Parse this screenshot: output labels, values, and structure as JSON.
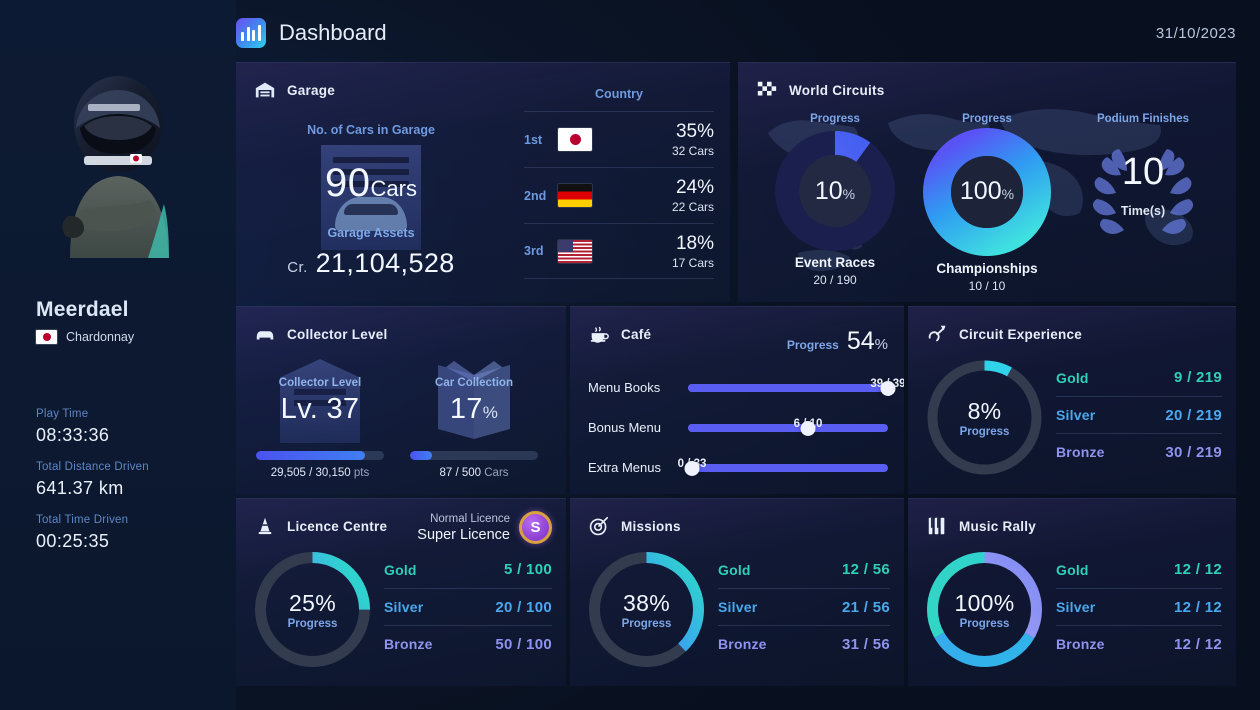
{
  "header": {
    "title": "Dashboard",
    "icon": "bar-chart-icon",
    "date": "31/10/2023"
  },
  "profile": {
    "name": "Meerdael",
    "region": "Chardonnay",
    "flag": "jp-flag-icon",
    "stats": [
      {
        "label": "Play Time",
        "value": "08:33:36"
      },
      {
        "label": "Total Distance Driven",
        "value": "641.37 km"
      },
      {
        "label": "Total Time Driven",
        "value": "00:25:35"
      }
    ]
  },
  "garage": {
    "title": "Garage",
    "icon": "garage-icon",
    "cars_caption": "No. of Cars in Garage",
    "cars_value": "90",
    "cars_unit": "Cars",
    "assets_label": "Garage Assets",
    "assets_prefix": "Cr.",
    "assets_value": "21,104,528",
    "country_header": "Country",
    "countries": [
      {
        "rank": "1st",
        "flag": "jp",
        "percent": "35%",
        "cars": "32 Cars"
      },
      {
        "rank": "2nd",
        "flag": "de",
        "percent": "24%",
        "cars": "22 Cars"
      },
      {
        "rank": "3rd",
        "flag": "us",
        "percent": "18%",
        "cars": "17 Cars"
      }
    ]
  },
  "world_circuits": {
    "title": "World Circuits",
    "icon": "checkered-flag-icon",
    "columns": [
      {
        "caption": "Progress",
        "center": "10",
        "center_unit": "%",
        "name": "Event Races",
        "sub": "20 / 190"
      },
      {
        "caption": "Progress",
        "center": "100",
        "center_unit": "%",
        "name": "Championships",
        "sub": "10 / 10"
      },
      {
        "caption": "Podium Finishes",
        "center": "10",
        "center_unit": "",
        "name": "",
        "sub": "Time(s)"
      }
    ]
  },
  "collector": {
    "title": "Collector Level",
    "icon": "car-front-icon",
    "items": [
      {
        "label": "Collector Level",
        "value": "Lv. 37",
        "bar_percent": 85,
        "progress_text": "29,505 / 30,150",
        "unit": "pts"
      },
      {
        "label": "Car Collection",
        "value": "17",
        "value_suffix": "%",
        "bar_percent": 17,
        "progress_text": "87 / 500",
        "unit": "Cars"
      }
    ]
  },
  "cafe": {
    "title": "Café",
    "icon": "coffee-cup-icon",
    "progress_label": "Progress",
    "progress_value": "54",
    "progress_unit": "%",
    "rows": [
      {
        "label": "Menu Books",
        "frac": "39 / 39",
        "percent": 100
      },
      {
        "label": "Bonus Menu",
        "frac": "6 / 10",
        "percent": 60
      },
      {
        "label": "Extra Menus",
        "frac": "0 / 33",
        "percent": 0
      }
    ]
  },
  "circuit_experience": {
    "title": "Circuit Experience",
    "icon": "steering-route-icon",
    "percent": "8%",
    "percent_value": 8,
    "progress_label": "Progress",
    "rows": [
      {
        "name": "Gold",
        "value": "9 / 219"
      },
      {
        "name": "Silver",
        "value": "20 / 219"
      },
      {
        "name": "Bronze",
        "value": "30 / 219"
      }
    ]
  },
  "licence": {
    "title": "Licence Centre",
    "icon": "traffic-cone-icon",
    "normal_label": "Normal Licence",
    "super_label": "Super Licence",
    "medal_letter": "S",
    "percent": "25%",
    "percent_value": 25,
    "progress_label": "Progress",
    "rows": [
      {
        "name": "Gold",
        "value": "5 / 100"
      },
      {
        "name": "Silver",
        "value": "20 / 100"
      },
      {
        "name": "Bronze",
        "value": "50 / 100"
      }
    ]
  },
  "missions": {
    "title": "Missions",
    "icon": "target-check-icon",
    "percent": "38%",
    "percent_value": 38,
    "progress_label": "Progress",
    "rows": [
      {
        "name": "Gold",
        "value": "12 / 56"
      },
      {
        "name": "Silver",
        "value": "21 / 56"
      },
      {
        "name": "Bronze",
        "value": "31 / 56"
      }
    ]
  },
  "music_rally": {
    "title": "Music Rally",
    "icon": "piano-keys-icon",
    "percent": "100%",
    "percent_value": 100,
    "progress_label": "Progress",
    "rows": [
      {
        "name": "Gold",
        "value": "12 / 12"
      },
      {
        "name": "Silver",
        "value": "12 / 12"
      },
      {
        "name": "Bronze",
        "value": "12 / 12"
      }
    ]
  },
  "colors": {
    "accent_blue": "#4aa8ef",
    "accent_purple": "#8f93f0",
    "accent_teal": "#2fcfb8",
    "caption_blue": "#7da6e8",
    "text_light": "#f2f7ff"
  }
}
